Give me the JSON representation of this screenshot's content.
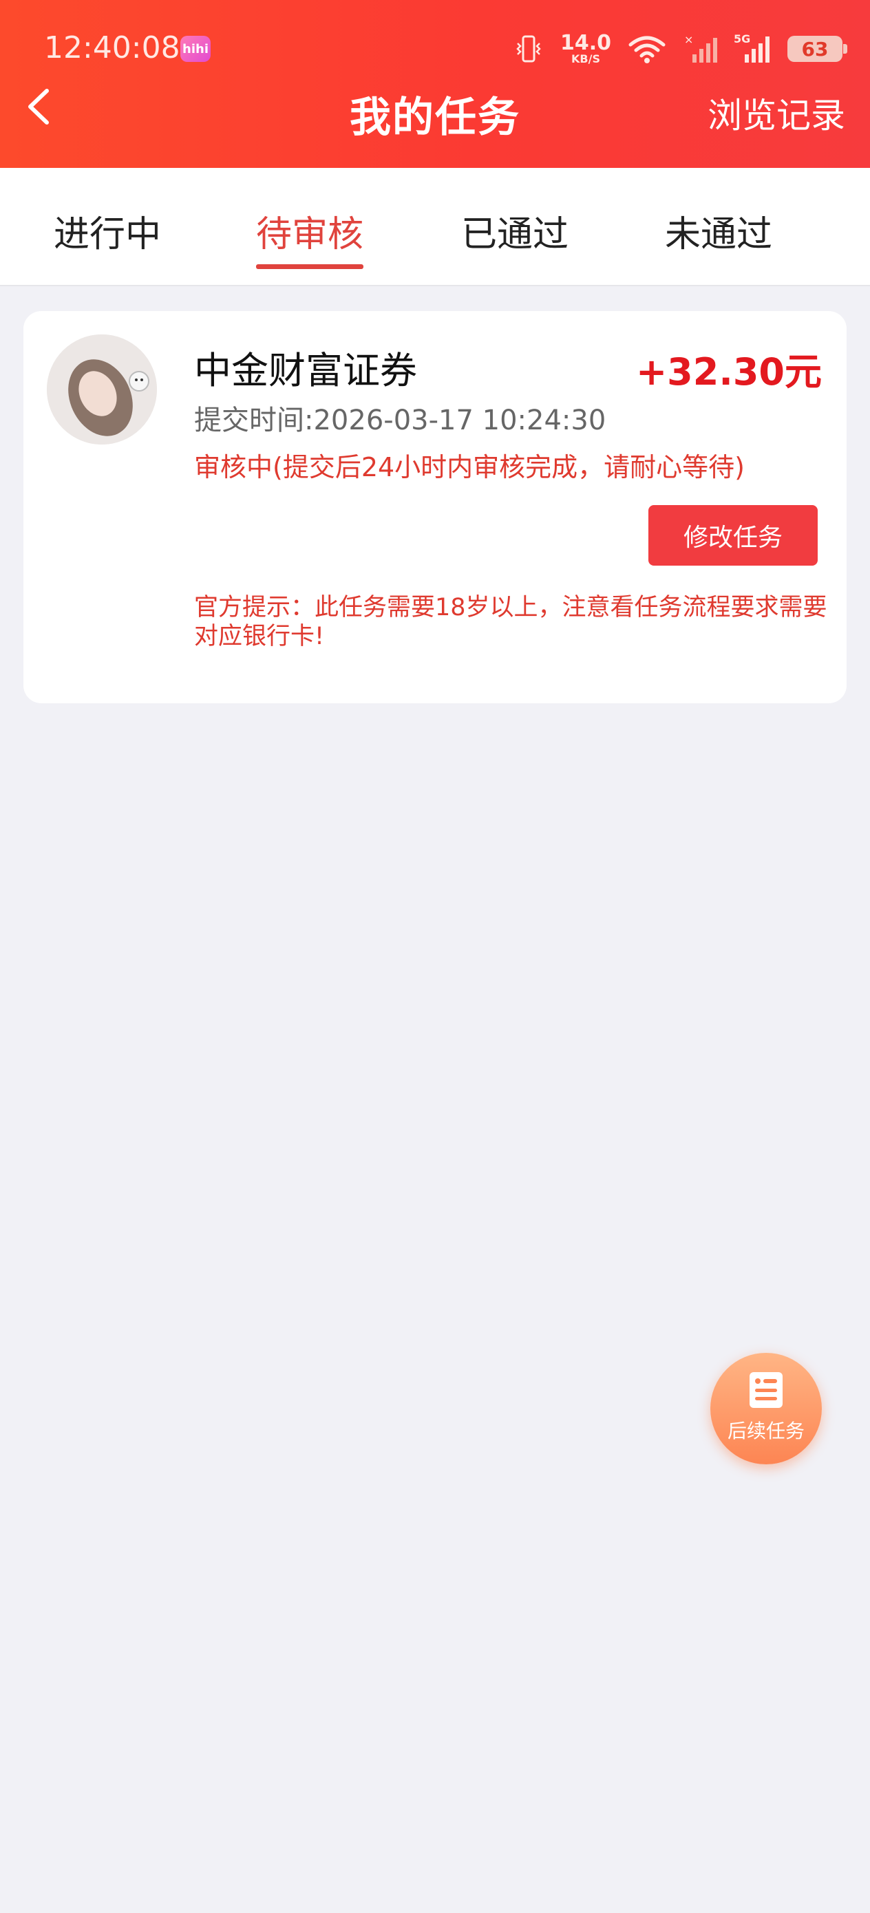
{
  "status_bar": {
    "time": "12:40:08",
    "app_badge": "hihi",
    "net_speed_value": "14.0",
    "net_speed_unit": "KB/S",
    "signal_label": "5G",
    "battery": "63"
  },
  "header": {
    "title": "我的任务",
    "history_link": "浏览记录",
    "back_icon": "chevron-left-icon"
  },
  "tabs": [
    {
      "label": "进行中",
      "active": false
    },
    {
      "label": "待审核",
      "active": true
    },
    {
      "label": "已通过",
      "active": false
    },
    {
      "label": "未通过",
      "active": false
    }
  ],
  "task_card": {
    "name": "中金财富证券",
    "reward": "+32.30元",
    "submit_time_label": "提交时间:",
    "submit_time_value": "2026-03-17 10:24:30",
    "review_status": "审核中(提交后24小时内审核完成，请耐心等待)",
    "modify_button": "修改任务",
    "official_tip": "官方提示：此任务需要18岁以上，注意看任务流程要求需要对应银行卡!"
  },
  "floating_button": {
    "label": "后续任务",
    "icon": "document-list-icon"
  },
  "colors": {
    "header_red": "#fb3a33",
    "accent_red": "#e0433d",
    "reward_red": "#e3191f",
    "fab_orange": "#fd8553",
    "background": "#f1f1f6"
  }
}
